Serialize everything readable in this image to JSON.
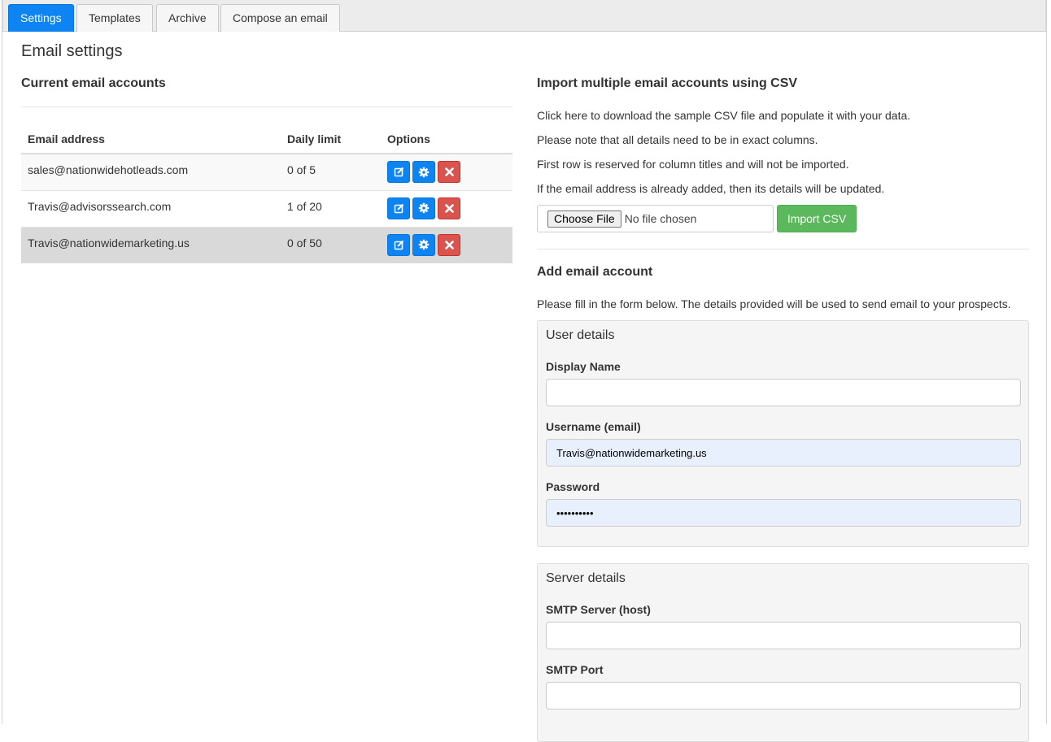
{
  "tabs": [
    {
      "label": "Settings",
      "active": true
    },
    {
      "label": "Templates",
      "active": false
    },
    {
      "label": "Archive",
      "active": false
    },
    {
      "label": "Compose an email",
      "active": false
    }
  ],
  "page_title": "Email settings",
  "accounts": {
    "heading": "Current email accounts",
    "columns": [
      "Email address",
      "Daily limit",
      "Options"
    ],
    "rows": [
      {
        "email": "sales@nationwidehotleads.com",
        "limit": "0 of 5"
      },
      {
        "email": "Travis@advisorssearch.com",
        "limit": "1 of 20"
      },
      {
        "email": "Travis@nationwidemarketing.us",
        "limit": "0 of 50"
      }
    ],
    "option_icons": [
      "edit-icon",
      "gear-icon",
      "delete-icon"
    ]
  },
  "csv_import": {
    "heading": "Import multiple email accounts using CSV",
    "lines": [
      "Click here to download the sample CSV file and populate it with your data.",
      "Please note that all details need to be in exact columns.",
      "First row is reserved for column titles and will not be imported.",
      "If the email address is already added, then its details will be updated."
    ],
    "choose_file_label": "Choose File",
    "file_status": "No file chosen",
    "import_button": "Import CSV"
  },
  "add_account": {
    "heading": "Add email account",
    "description": "Please fill in the form below. The details provided will be used to send email to your prospects.",
    "user_details": {
      "title": "User details",
      "display_name_label": "Display Name",
      "display_name_value": "",
      "username_label": "Username (email)",
      "username_value": "Travis@nationwidemarketing.us",
      "password_label": "Password",
      "password_value": "••••••••••"
    },
    "server_details": {
      "title": "Server details",
      "smtp_host_label": "SMTP Server (host)",
      "smtp_host_value": "",
      "smtp_port_label": "SMTP Port",
      "smtp_port_value": ""
    }
  },
  "colors": {
    "primary": "#0d84f2",
    "success": "#5cb85c",
    "danger": "#d9534f",
    "autofill": "#e8f0fe"
  }
}
